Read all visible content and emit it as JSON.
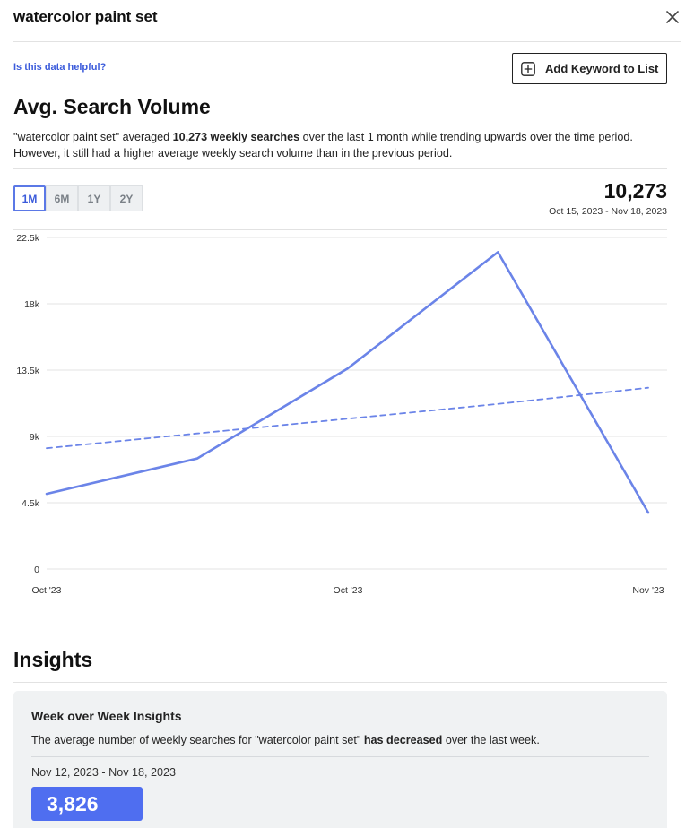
{
  "header": {
    "title": "watercolor paint set"
  },
  "helpful_link": "Is this data helpful?",
  "add_button": {
    "label": "Add Keyword to List"
  },
  "search_volume": {
    "title": "Avg. Search Volume",
    "desc_pre": "\"watercolor paint set\" averaged ",
    "desc_bold": "10,273 weekly searches",
    "desc_post": " over the last 1 month while trending upwards over the time period. However, it still had a higher average weekly search volume than in the previous period.",
    "ranges": [
      "1M",
      "6M",
      "1Y",
      "2Y"
    ],
    "active_range": "1M",
    "stat_value": "10,273",
    "stat_range": "Oct 15, 2023 - Nov 18, 2023"
  },
  "chart_data": {
    "type": "line",
    "x_tick_labels": [
      "Oct '23",
      "Oct '23",
      "Nov '23"
    ],
    "y_tick_labels": [
      "0",
      "4.5k",
      "9k",
      "13.5k",
      "18k",
      "22.5k"
    ],
    "ylim": [
      0,
      22500
    ],
    "grid": true,
    "series": [
      {
        "values": [
          5100,
          7500,
          13600,
          21500,
          3826
        ],
        "style": "solid",
        "color": "#6b84e8"
      },
      {
        "values": [
          8200,
          9200,
          10200,
          11200,
          12300
        ],
        "style": "dashed",
        "color": "#6b84e8"
      }
    ]
  },
  "insights": {
    "title": "Insights",
    "card_title": "Week over Week Insights",
    "card_text_pre": "The average number of weekly searches for \"watercolor paint set\" ",
    "card_text_bold": "has decreased",
    "card_text_post": " over the last week.",
    "period": "Nov 12, 2023 - Nov 18, 2023",
    "value": "3,826"
  },
  "colors": {
    "accent": "#4f6ef0",
    "line": "#6b84e8",
    "link": "#3b5bdb"
  },
  "icons": {
    "close": "close-icon",
    "add": "plus-square-icon"
  }
}
